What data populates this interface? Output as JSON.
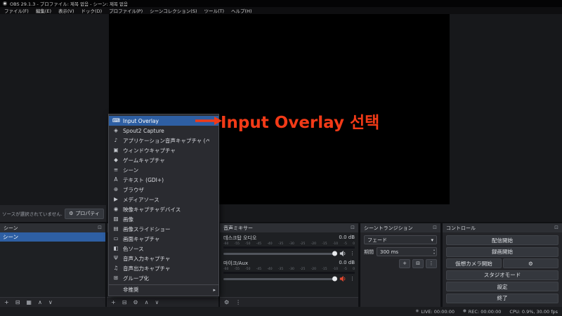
{
  "colors": {
    "selection_blue": "#2e5fa3",
    "annotation_red": "#f23a17"
  },
  "icons": {
    "popout": "⊡",
    "gear": "⚙",
    "trash": "⊟",
    "plus": "+",
    "kebab": "⋮",
    "up": "∧",
    "down": "∨",
    "caret": "▾",
    "spin_up": "▴",
    "spin_down": "▾",
    "submenu": "▸",
    "dot": "●",
    "signal": "◉",
    "grid": "▦"
  },
  "titlebar": {
    "title": "OBS 29.1.3 - プロファイル: 제목 없음 - シーン: 제목 없음"
  },
  "menubar": {
    "items": [
      "ファイル(F)",
      "編集(E)",
      "表示(V)",
      "ドック(D)",
      "プロファイル(P)",
      "シーンコレクション(S)",
      "ツール(T)",
      "ヘルプ(H)"
    ]
  },
  "annotation": {
    "label": "Input Overlay 선택",
    "color": "#f23a17"
  },
  "context_menu": {
    "items": [
      {
        "icon": "keyboard-icon",
        "glyph": "⌨",
        "label": "Input Overlay",
        "selected": true
      },
      {
        "icon": "spout-icon",
        "glyph": "◈",
        "label": "Spout2 Capture"
      },
      {
        "icon": "app-audio-icon",
        "glyph": "♪",
        "label": "アプリケーション音声キャプチャ (ベータ版)"
      },
      {
        "icon": "window-icon",
        "glyph": "▣",
        "label": "ウィンドウキャプチャ"
      },
      {
        "icon": "game-icon",
        "glyph": "◆",
        "label": "ゲームキャプチャ"
      },
      {
        "icon": "scene-icon",
        "glyph": "≡",
        "label": "シーン"
      },
      {
        "icon": "text-icon",
        "glyph": "A",
        "label": "テキスト (GDI+)"
      },
      {
        "icon": "browser-icon",
        "glyph": "⊕",
        "label": "ブラウザ"
      },
      {
        "icon": "media-icon",
        "glyph": "▶",
        "label": "メディアソース"
      },
      {
        "icon": "camera-icon",
        "glyph": "◉",
        "label": "映像キャプチャデバイス"
      },
      {
        "icon": "image-icon",
        "glyph": "▨",
        "label": "画像"
      },
      {
        "icon": "slideshow-icon",
        "glyph": "▤",
        "label": "画像スライドショー"
      },
      {
        "icon": "display-icon",
        "glyph": "▭",
        "label": "画面キャプチャ"
      },
      {
        "icon": "color-icon",
        "glyph": "◧",
        "label": "色ソース"
      },
      {
        "icon": "mic-icon",
        "glyph": "Ψ",
        "label": "音声入力キャプチャ"
      },
      {
        "icon": "speaker-icon",
        "glyph": "♫",
        "label": "音声出力キャプチャ"
      },
      {
        "icon": "group-icon",
        "glyph": "⊞",
        "label": "グループ化"
      },
      {
        "icon": "",
        "glyph": "",
        "label": "非推奨",
        "submenu": true,
        "separator": true
      }
    ]
  },
  "properties_bar": {
    "message": "ソースが選択されていません.",
    "button_label": "プロパティ"
  },
  "scenes": {
    "title": "シーン",
    "items": [
      {
        "label": "シーン",
        "selected": true
      }
    ]
  },
  "mixer": {
    "title": "音声ミキサー",
    "scale": [
      "-60",
      "-55",
      "-50",
      "-45",
      "-40",
      "-35",
      "-30",
      "-25",
      "-20",
      "-15",
      "-10",
      "-5",
      "0"
    ],
    "channels": [
      {
        "name": "데스크탑 오디오",
        "db": "0.0 dB"
      },
      {
        "name": "마이크/Aux",
        "db": "0.0 dB"
      }
    ]
  },
  "transitions": {
    "title": "シーントランジション",
    "current": "フェード",
    "duration_label": "期間",
    "duration_value": "300 ms"
  },
  "controls": {
    "title": "コントロール",
    "buttons": [
      "配信開始",
      "録画開始",
      "仮想カメラ開始",
      "スタジオモード",
      "設定",
      "終了"
    ]
  },
  "statusbar": {
    "live": "LIVE: 00:00:00",
    "rec": "REC: 00:00:00",
    "stats": "CPU: 0.9%, 30.00 fps"
  }
}
